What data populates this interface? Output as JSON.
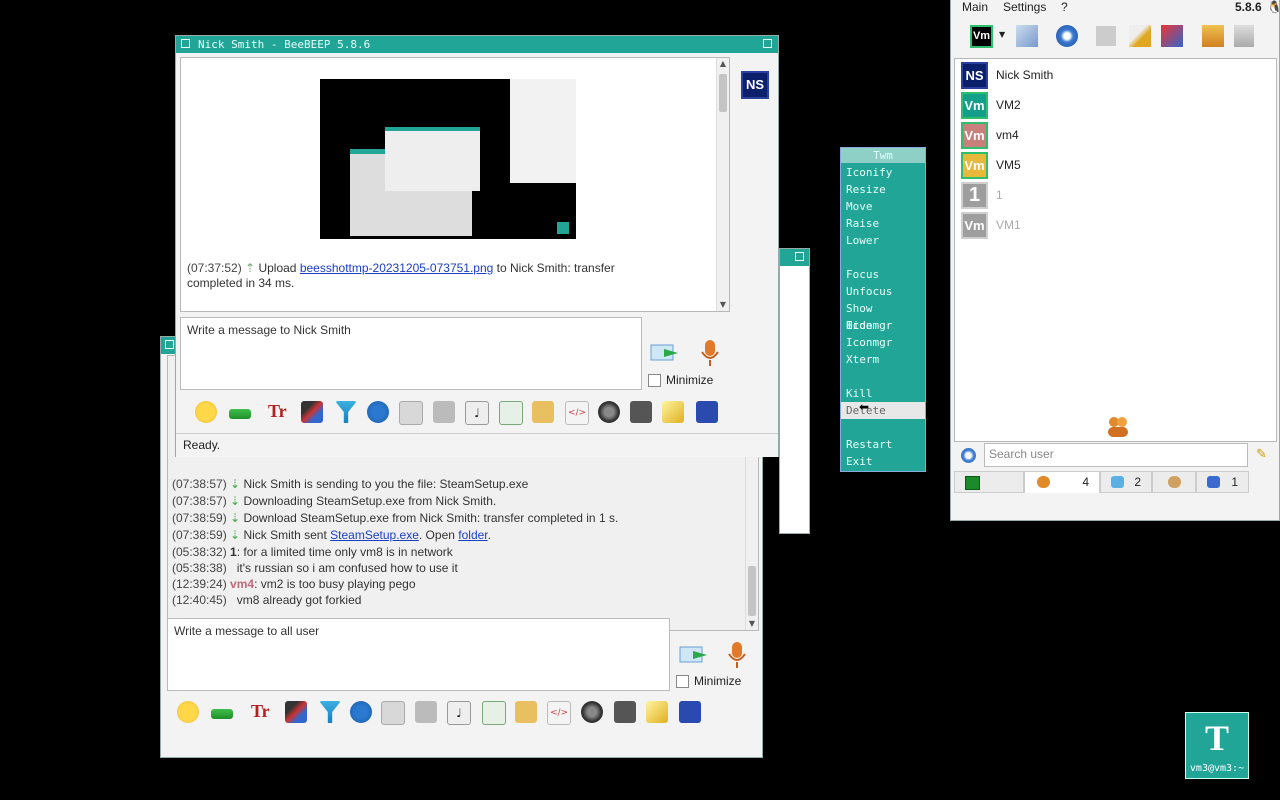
{
  "chat_window_nick": {
    "title": "Nick Smith - BeeBEEP 5.8.6",
    "avatar_initials": "NS",
    "upload_time": "(07:37:52)",
    "upload_prefix": "Upload",
    "upload_link": "beesshottmp-20231205-073751.png",
    "upload_suffix": "to Nick Smith: transfer",
    "upload_suffix2": "completed in 34 ms.",
    "input_placeholder": "Write a message to Nick Smith",
    "minimize_label": "Minimize",
    "status": "Ready."
  },
  "chat_window_all": {
    "messages": [
      {
        "time": "(07:38:57)",
        "text": "Nick Smith is sending to you the file: SteamSetup.exe"
      },
      {
        "time": "(07:38:57)",
        "text": "Downloading SteamSetup.exe from Nick Smith."
      },
      {
        "time": "(07:38:59)",
        "text": "Download SteamSetup.exe from Nick Smith: transfer completed in 1 s."
      }
    ],
    "sent_time": "(07:38:59)",
    "sent_prefix": "Nick Smith sent",
    "sent_link": "SteamSetup.exe",
    "sent_mid": ". Open",
    "sent_folder": "folder",
    "sent_end": ".",
    "chat": [
      {
        "time": "(05:38:32)",
        "user": "1",
        "text": ": for a limited time only vm8 is in network"
      },
      {
        "time": "(05:38:38)",
        "user": "",
        "text": "it's russian so i am confused how to use it"
      },
      {
        "time": "(12:39:24)",
        "user": "vm4",
        "text": ": vm2 is too busy playing pego"
      },
      {
        "time": "(12:40:45)",
        "user": "",
        "text": "vm8 already got forkied"
      }
    ],
    "input_placeholder": "Write a message to all user",
    "minimize_label": "Minimize"
  },
  "twm_menu": {
    "title": "Twm",
    "items": [
      "Iconify",
      "Resize",
      "Move",
      "Raise",
      "Lower",
      "",
      "Focus",
      "Unfocus",
      "Show Iconmgr",
      "Hide Iconmgr",
      "",
      "Xterm",
      "",
      "Kill",
      "Delete",
      "",
      "Restart",
      "Exit"
    ]
  },
  "main_window": {
    "menu": [
      "Main",
      "Settings",
      "?"
    ],
    "version": "5.8.6",
    "top_avatar": "Vm",
    "users": [
      {
        "initials": "NS",
        "name": "Nick Smith",
        "bg": "#0b1f6b",
        "border": "#2a3fa0",
        "online": true
      },
      {
        "initials": "Vm",
        "name": "VM2",
        "bg": "#149e8c",
        "border": "#2dbf6b",
        "online": true
      },
      {
        "initials": "Vm",
        "name": "vm4",
        "bg": "#c9807c",
        "border": "#2dbf6b",
        "online": true
      },
      {
        "initials": "Vm",
        "name": "VM5",
        "bg": "#e8b83a",
        "border": "#2dbf6b",
        "online": true
      },
      {
        "initials": "1",
        "name": "1",
        "bg": "#9e9e9e",
        "border": "#cfcfcf",
        "online": false
      },
      {
        "initials": "Vm",
        "name": "VM1",
        "bg": "#9e9e9e",
        "border": "#cfcfcf",
        "online": false
      }
    ],
    "search_placeholder": "Search user",
    "tabs": [
      "",
      "4",
      "2",
      "",
      "1"
    ]
  },
  "xterm_icon": {
    "label": "vm3@vm3:~"
  },
  "colors": {
    "twm_teal": "#21a597",
    "link": "#1a3fc4"
  }
}
